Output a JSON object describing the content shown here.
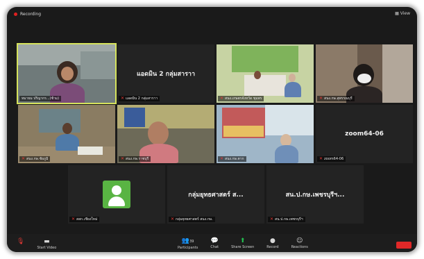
{
  "meeting": {
    "recording_label": "Recording",
    "view_label": "View"
  },
  "tiles": [
    {
      "id": "t1",
      "type": "video",
      "name": "หมายม ปริญากร...(ซ้าม)",
      "muted": false,
      "active": true
    },
    {
      "id": "t2",
      "type": "name",
      "display": "แอดมิน 2 กลุ่มสาราา",
      "name": "แอดมิน 2 กลุ่มสาราา",
      "muted": true
    },
    {
      "id": "t3",
      "type": "video",
      "name": "สนง.เกษตรจังหวัด ชุมพร",
      "muted": true
    },
    {
      "id": "t4",
      "type": "video",
      "name": "สนง.กษ.สุพรรณบุรี",
      "muted": true
    },
    {
      "id": "t5",
      "type": "video",
      "name": "สนง.กษ.ชัยภูมิ",
      "muted": true
    },
    {
      "id": "t6",
      "type": "video",
      "name": "สนง.กษ.ราชบุรี",
      "muted": true
    },
    {
      "id": "t7",
      "type": "video",
      "name": "สนง.กษ.ตาก",
      "muted": true
    },
    {
      "id": "t8",
      "type": "name",
      "display": "zoom64-06",
      "name": "zoom64-06",
      "muted": true
    },
    {
      "id": "t9",
      "type": "avatar",
      "name": "สสก.เชียงใหม่",
      "muted": true
    },
    {
      "id": "t10",
      "type": "name",
      "display": "กลุ่มยุทธศาสตร์ ส...",
      "name": "กลุ่มยุทธศาสตร์ สนง.กษ.",
      "muted": true
    },
    {
      "id": "t11",
      "type": "name",
      "display": "สน.ป.กษ.เพชรบุรีฯ...",
      "name": "สน.ป.กษ.เพชรบุรีฯ",
      "muted": true
    }
  ],
  "toolbar": {
    "start_video": "Start Video",
    "participants": "Participants",
    "participants_count": "39",
    "chat": "Chat",
    "share_screen": "Share Screen",
    "record": "Record",
    "reactions": "Reactions"
  }
}
